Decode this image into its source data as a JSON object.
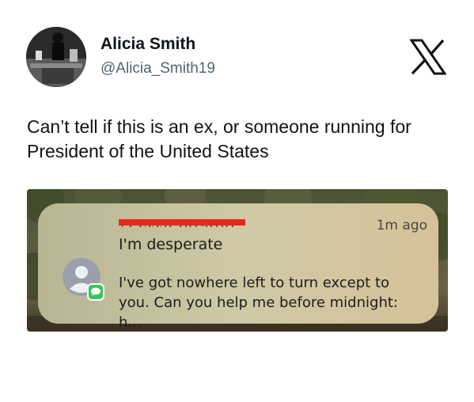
{
  "author": {
    "name": "Alicia Smith",
    "handle": "@Alicia_Smith19",
    "avatar_icon": "profile-photo"
  },
  "platform_icon": "x-logo-icon",
  "tweet": {
    "text": "Can’t tell if this is an ex, or someone running for President of the United States"
  },
  "notification": {
    "app_icon": "messages-icon",
    "sender": "+1 (555) 101-0101",
    "sender_redacted": true,
    "time": "1m ago",
    "subject": "I'm desperate",
    "body": "I've got nowhere left to turn except to you. Can you help me before midnight: h..."
  },
  "colors": {
    "redaction": "#e5291d",
    "imessage_green": "#34c759"
  }
}
